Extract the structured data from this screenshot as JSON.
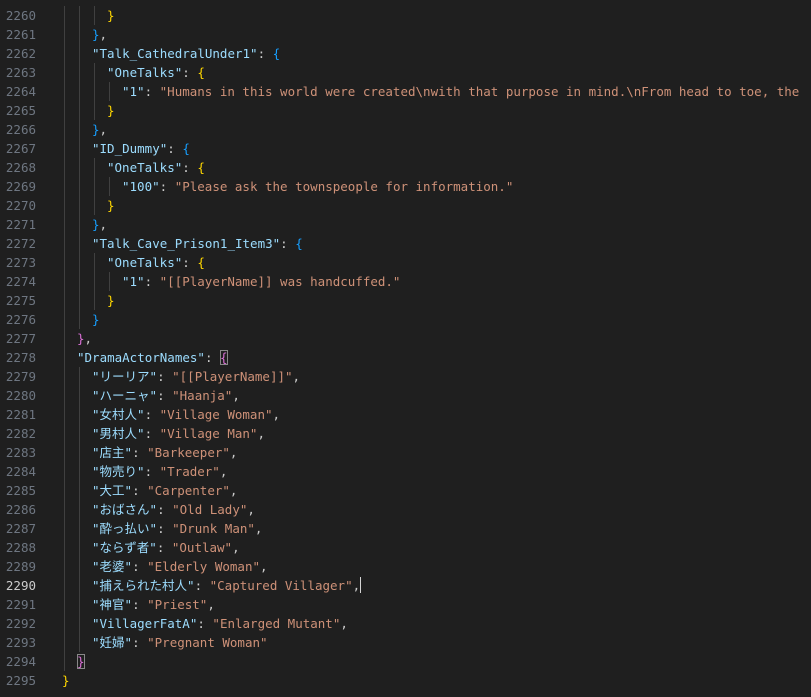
{
  "editor": {
    "active_line": "2290",
    "lines": [
      {
        "no": "2260",
        "indent": 6,
        "tokens": [
          {
            "t": "}",
            "c": "b1"
          }
        ]
      },
      {
        "no": "2261",
        "indent": 4,
        "tokens": [
          {
            "t": "}",
            "c": "b3"
          },
          {
            "t": ",",
            "c": "p"
          }
        ]
      },
      {
        "no": "2262",
        "indent": 4,
        "tokens": [
          {
            "t": "\"Talk_CathedralUnder1\"",
            "c": "k"
          },
          {
            "t": ": ",
            "c": "p"
          },
          {
            "t": "{",
            "c": "b3"
          }
        ]
      },
      {
        "no": "2263",
        "indent": 6,
        "tokens": [
          {
            "t": "\"OneTalks\"",
            "c": "k"
          },
          {
            "t": ": ",
            "c": "p"
          },
          {
            "t": "{",
            "c": "b1"
          }
        ]
      },
      {
        "no": "2264",
        "indent": 8,
        "tokens": [
          {
            "t": "\"1\"",
            "c": "k"
          },
          {
            "t": ": ",
            "c": "p"
          },
          {
            "t": "\"Humans in this world were created\\nwith that purpose in mind.\\nFrom head to toe, the",
            "c": "s"
          }
        ]
      },
      {
        "no": "2265",
        "indent": 6,
        "tokens": [
          {
            "t": "}",
            "c": "b1"
          }
        ]
      },
      {
        "no": "2266",
        "indent": 4,
        "tokens": [
          {
            "t": "}",
            "c": "b3"
          },
          {
            "t": ",",
            "c": "p"
          }
        ]
      },
      {
        "no": "2267",
        "indent": 4,
        "tokens": [
          {
            "t": "\"ID_Dummy\"",
            "c": "k"
          },
          {
            "t": ": ",
            "c": "p"
          },
          {
            "t": "{",
            "c": "b3"
          }
        ]
      },
      {
        "no": "2268",
        "indent": 6,
        "tokens": [
          {
            "t": "\"OneTalks\"",
            "c": "k"
          },
          {
            "t": ": ",
            "c": "p"
          },
          {
            "t": "{",
            "c": "b1"
          }
        ]
      },
      {
        "no": "2269",
        "indent": 8,
        "tokens": [
          {
            "t": "\"100\"",
            "c": "k"
          },
          {
            "t": ": ",
            "c": "p"
          },
          {
            "t": "\"Please ask the townspeople for information.\"",
            "c": "s"
          }
        ]
      },
      {
        "no": "2270",
        "indent": 6,
        "tokens": [
          {
            "t": "}",
            "c": "b1"
          }
        ]
      },
      {
        "no": "2271",
        "indent": 4,
        "tokens": [
          {
            "t": "}",
            "c": "b3"
          },
          {
            "t": ",",
            "c": "p"
          }
        ]
      },
      {
        "no": "2272",
        "indent": 4,
        "tokens": [
          {
            "t": "\"Talk_Cave_Prison1_Item3\"",
            "c": "k"
          },
          {
            "t": ": ",
            "c": "p"
          },
          {
            "t": "{",
            "c": "b3"
          }
        ]
      },
      {
        "no": "2273",
        "indent": 6,
        "tokens": [
          {
            "t": "\"OneTalks\"",
            "c": "k"
          },
          {
            "t": ": ",
            "c": "p"
          },
          {
            "t": "{",
            "c": "b1"
          }
        ]
      },
      {
        "no": "2274",
        "indent": 8,
        "tokens": [
          {
            "t": "\"1\"",
            "c": "k"
          },
          {
            "t": ": ",
            "c": "p"
          },
          {
            "t": "\"[[PlayerName]] was handcuffed.\"",
            "c": "s"
          }
        ]
      },
      {
        "no": "2275",
        "indent": 6,
        "tokens": [
          {
            "t": "}",
            "c": "b1"
          }
        ]
      },
      {
        "no": "2276",
        "indent": 4,
        "tokens": [
          {
            "t": "}",
            "c": "b3"
          }
        ]
      },
      {
        "no": "2277",
        "indent": 2,
        "tokens": [
          {
            "t": "}",
            "c": "b2"
          },
          {
            "t": ",",
            "c": "p"
          }
        ]
      },
      {
        "no": "2278",
        "indent": 2,
        "tokens": [
          {
            "t": "\"DramaActorNames\"",
            "c": "k"
          },
          {
            "t": ": ",
            "c": "p"
          },
          {
            "t": "{",
            "c": "b2 bm"
          }
        ]
      },
      {
        "no": "2279",
        "indent": 4,
        "tokens": [
          {
            "t": "\"リーリア\"",
            "c": "k"
          },
          {
            "t": ": ",
            "c": "p"
          },
          {
            "t": "\"[[PlayerName]]\"",
            "c": "s"
          },
          {
            "t": ",",
            "c": "p"
          }
        ]
      },
      {
        "no": "2280",
        "indent": 4,
        "tokens": [
          {
            "t": "\"ハーニャ\"",
            "c": "k"
          },
          {
            "t": ": ",
            "c": "p"
          },
          {
            "t": "\"Haanja\"",
            "c": "s"
          },
          {
            "t": ",",
            "c": "p"
          }
        ]
      },
      {
        "no": "2281",
        "indent": 4,
        "tokens": [
          {
            "t": "\"女村人\"",
            "c": "k"
          },
          {
            "t": ": ",
            "c": "p"
          },
          {
            "t": "\"Village Woman\"",
            "c": "s"
          },
          {
            "t": ",",
            "c": "p"
          }
        ]
      },
      {
        "no": "2282",
        "indent": 4,
        "tokens": [
          {
            "t": "\"男村人\"",
            "c": "k"
          },
          {
            "t": ": ",
            "c": "p"
          },
          {
            "t": "\"Village Man\"",
            "c": "s"
          },
          {
            "t": ",",
            "c": "p"
          }
        ]
      },
      {
        "no": "2283",
        "indent": 4,
        "tokens": [
          {
            "t": "\"店主\"",
            "c": "k"
          },
          {
            "t": ": ",
            "c": "p"
          },
          {
            "t": "\"Barkeeper\"",
            "c": "s"
          },
          {
            "t": ",",
            "c": "p"
          }
        ]
      },
      {
        "no": "2284",
        "indent": 4,
        "tokens": [
          {
            "t": "\"物売り\"",
            "c": "k"
          },
          {
            "t": ": ",
            "c": "p"
          },
          {
            "t": "\"Trader\"",
            "c": "s"
          },
          {
            "t": ",",
            "c": "p"
          }
        ]
      },
      {
        "no": "2285",
        "indent": 4,
        "tokens": [
          {
            "t": "\"大工\"",
            "c": "k"
          },
          {
            "t": ": ",
            "c": "p"
          },
          {
            "t": "\"Carpenter\"",
            "c": "s"
          },
          {
            "t": ",",
            "c": "p"
          }
        ]
      },
      {
        "no": "2286",
        "indent": 4,
        "tokens": [
          {
            "t": "\"おばさん\"",
            "c": "k"
          },
          {
            "t": ": ",
            "c": "p"
          },
          {
            "t": "\"Old Lady\"",
            "c": "s"
          },
          {
            "t": ",",
            "c": "p"
          }
        ]
      },
      {
        "no": "2287",
        "indent": 4,
        "tokens": [
          {
            "t": "\"酔っ払い\"",
            "c": "k"
          },
          {
            "t": ": ",
            "c": "p"
          },
          {
            "t": "\"Drunk Man\"",
            "c": "s"
          },
          {
            "t": ",",
            "c": "p"
          }
        ]
      },
      {
        "no": "2288",
        "indent": 4,
        "tokens": [
          {
            "t": "\"ならず者\"",
            "c": "k"
          },
          {
            "t": ": ",
            "c": "p"
          },
          {
            "t": "\"Outlaw\"",
            "c": "s"
          },
          {
            "t": ",",
            "c": "p"
          }
        ]
      },
      {
        "no": "2289",
        "indent": 4,
        "tokens": [
          {
            "t": "\"老婆\"",
            "c": "k"
          },
          {
            "t": ": ",
            "c": "p"
          },
          {
            "t": "\"Elderly Woman\"",
            "c": "s"
          },
          {
            "t": ",",
            "c": "p"
          }
        ]
      },
      {
        "no": "2290",
        "indent": 4,
        "cursor": true,
        "tokens": [
          {
            "t": "\"捕えられた村人\"",
            "c": "k"
          },
          {
            "t": ": ",
            "c": "p"
          },
          {
            "t": "\"Captured Villager\"",
            "c": "s"
          },
          {
            "t": ",",
            "c": "p"
          }
        ]
      },
      {
        "no": "2291",
        "indent": 4,
        "tokens": [
          {
            "t": "\"神官\"",
            "c": "k"
          },
          {
            "t": ": ",
            "c": "p"
          },
          {
            "t": "\"Priest\"",
            "c": "s"
          },
          {
            "t": ",",
            "c": "p"
          }
        ]
      },
      {
        "no": "2292",
        "indent": 4,
        "tokens": [
          {
            "t": "\"VillagerFatA\"",
            "c": "k"
          },
          {
            "t": ": ",
            "c": "p"
          },
          {
            "t": "\"Enlarged Mutant\"",
            "c": "s"
          },
          {
            "t": ",",
            "c": "p"
          }
        ]
      },
      {
        "no": "2293",
        "indent": 4,
        "tokens": [
          {
            "t": "\"妊婦\"",
            "c": "k"
          },
          {
            "t": ": ",
            "c": "p"
          },
          {
            "t": "\"Pregnant Woman\"",
            "c": "s"
          }
        ]
      },
      {
        "no": "2294",
        "indent": 2,
        "tokens": [
          {
            "t": "}",
            "c": "b2 bm"
          }
        ]
      },
      {
        "no": "2295",
        "indent": 0,
        "tokens": [
          {
            "t": "}",
            "c": "b1"
          }
        ]
      }
    ]
  },
  "colors": {
    "background": "#1f1f1f",
    "line_number": "#6e7681",
    "line_number_active": "#cccccc",
    "key": "#9cdcfe",
    "string": "#ce9178",
    "bracket_level1": "#ffd700",
    "bracket_level2": "#da70d6",
    "bracket_level3": "#179fff"
  }
}
